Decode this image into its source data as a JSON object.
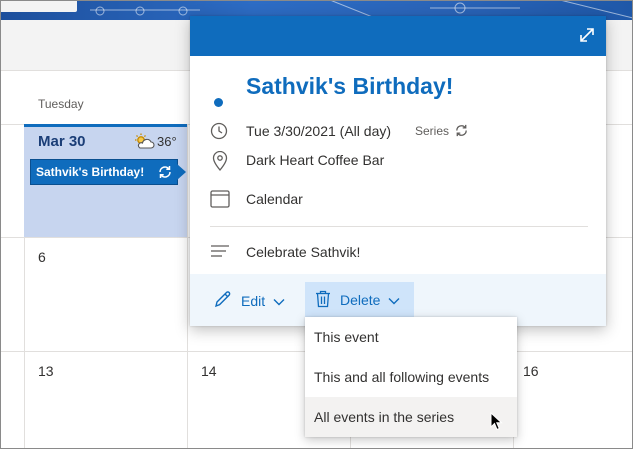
{
  "calendar": {
    "day_header": "Tuesday",
    "today": {
      "date": "Mar 30",
      "weather_temp": "36°",
      "weather_icon": "partly-sunny-icon"
    },
    "event_chip": {
      "label": "Sathvik's Birthday!",
      "icon": "recurrence-icon"
    },
    "day_numbers": [
      "6",
      "13",
      "14",
      "16"
    ]
  },
  "popup": {
    "title": "Sathvik's Birthday!",
    "date_line": "Tue 3/30/2021 (All day)",
    "series_label": "Series",
    "location": "Dark Heart Coffee Bar",
    "calendar_name": "Calendar",
    "notes": "Celebrate Sathvik!",
    "actions": {
      "edit": "Edit",
      "delete": "Delete"
    }
  },
  "delete_menu": {
    "items": [
      "This event",
      "This and all following events",
      "All events in the series"
    ],
    "hovered_index": 2
  },
  "colors": {
    "accent": "#0f6cbd",
    "today_bg": "#c7d5ef",
    "action_bar_bg": "#eff6fc",
    "delete_btn_bg": "#cfe4fa"
  }
}
